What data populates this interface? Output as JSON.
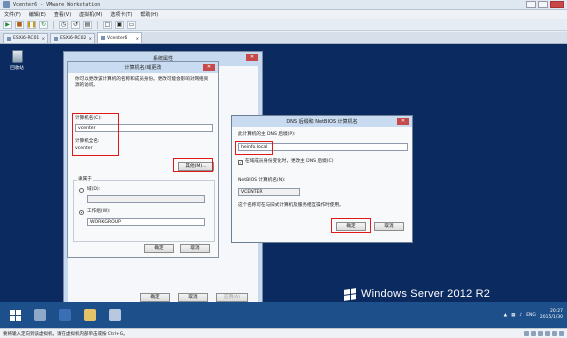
{
  "vmware": {
    "title": "Vcenter6 - VMware Workstation",
    "menu": [
      "文件(F)",
      "编辑(E)",
      "查看(V)",
      "虚拟机(M)",
      "选项卡(T)",
      "帮助(H)"
    ],
    "tabs": [
      {
        "label": "ESXi6-RC01",
        "close": "×"
      },
      {
        "label": "ESXi6-RC02",
        "close": "×"
      },
      {
        "label": "Vcenter6",
        "close": "×"
      }
    ],
    "status_text": "要将输入定向到该虚拟机，请在虚拟机内部单击或按 Ctrl+G。"
  },
  "desktop": {
    "recycle_bin_label": "回收站",
    "brand_text": "Windows Server 2012 R2"
  },
  "system_properties": {
    "title": "系统属性",
    "close": "✕",
    "ok_label": "确定",
    "cancel_label": "取消",
    "apply_label": "应用(A)"
  },
  "computer_name_dialog": {
    "title": "计算机名/域更改",
    "close": "✕",
    "description_line1": "你可以更改该计算机的名称和成员身份。更改可能会影响对网络资",
    "description_line2": "源的访问。",
    "computer_name_label": "计算机名(C):",
    "computer_name_value": "vcenter",
    "full_name_label": "计算机全名:",
    "full_name_value": "vcenter",
    "other_button": "其他(M)...",
    "member_of_label": "隶属于",
    "domain_label": "域(D):",
    "workgroup_label": "工作组(W):",
    "workgroup_value": "WORKGROUP",
    "ok_label": "确定",
    "cancel_label": "取消"
  },
  "dns_dialog": {
    "title": "DNS 后缀和 NetBIOS 计算机名",
    "close": "✕",
    "primary_suffix_label": "此计算机的主 DNS 后缀(P):",
    "primary_suffix_value": "heinfo.local",
    "change_checkbox_label": "在域成员身份变化时，更改主 DNS 后缀(C)",
    "change_checkbox_mark": "✓",
    "netbios_label": "NetBIOS 计算机名(N):",
    "netbios_value": "VCENTER",
    "note": "这个名称可在与旧式计算机及服务相互操作时使用。",
    "ok_label": "确定",
    "cancel_label": "取消"
  },
  "taskbar": {
    "lang": "ENG",
    "time": "20:27",
    "date": "2015/1/30"
  }
}
